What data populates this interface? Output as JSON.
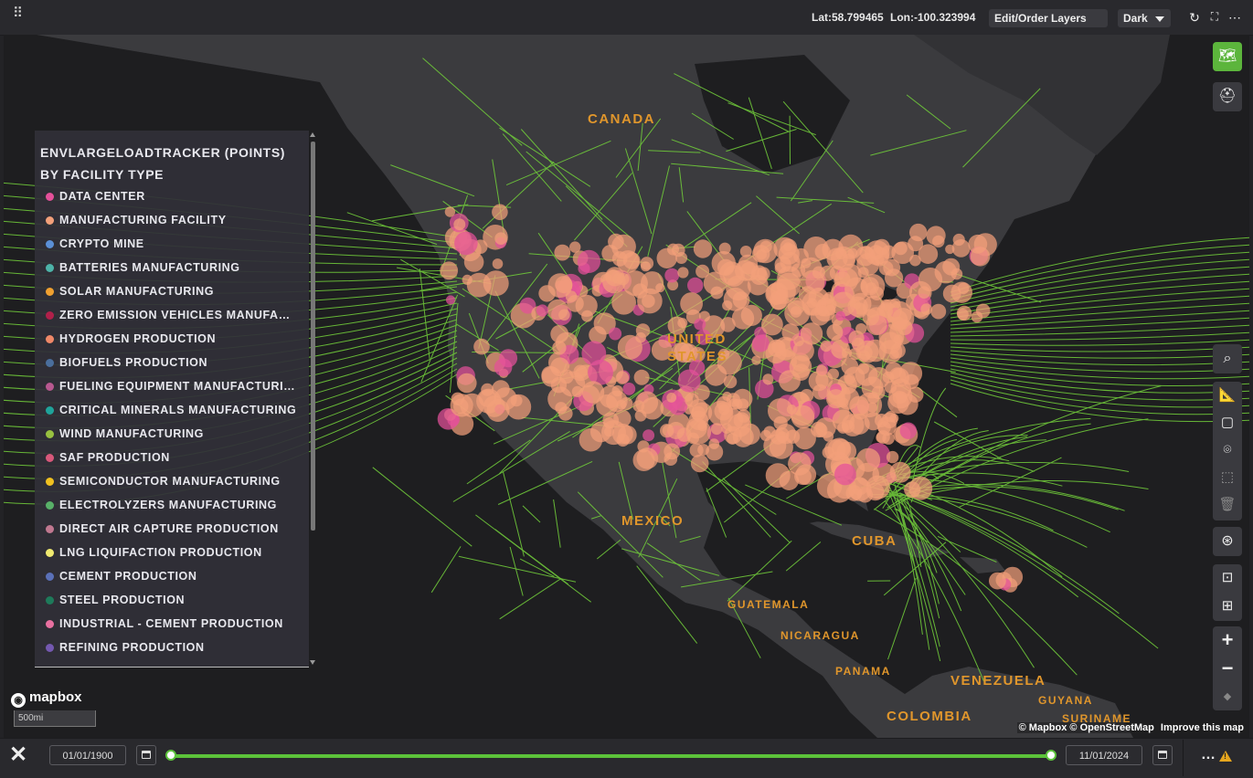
{
  "topbar": {
    "lat": "Lat:58.799465",
    "lon": "Lon:-100.323994",
    "layers_dropdown": "Edit/Order Layers",
    "theme_dropdown": "Dark"
  },
  "legend": {
    "title": "ENVLARGELOADTRACKER (POINTS) BY FACILITY TYPE",
    "items": [
      {
        "label": "DATA CENTER",
        "color": "#e4509a"
      },
      {
        "label": "MANUFACTURING FACILITY",
        "color": "#f2a07a"
      },
      {
        "label": "CRYPTO MINE",
        "color": "#5b8fd6"
      },
      {
        "label": "BATTERIES MANUFACTURING",
        "color": "#4db3a8"
      },
      {
        "label": "SOLAR MANUFACTURING",
        "color": "#f0a030"
      },
      {
        "label": "ZERO EMISSION VEHICLES MANUFACTU...",
        "color": "#b0204a"
      },
      {
        "label": "HYDROGEN PRODUCTION",
        "color": "#f08868"
      },
      {
        "label": "BIOFUELS PRODUCTION",
        "color": "#4a6e9c"
      },
      {
        "label": "FUELING EQUIPMENT MANUFACTURING",
        "color": "#b85890"
      },
      {
        "label": "CRITICAL MINERALS MANUFACTURING",
        "color": "#1fa39a"
      },
      {
        "label": "WIND MANUFACTURING",
        "color": "#98c040"
      },
      {
        "label": "SAF PRODUCTION",
        "color": "#d8587a"
      },
      {
        "label": "SEMICONDUCTOR MANUFACTURING",
        "color": "#f0c020"
      },
      {
        "label": "ELECTROLYZERS MANUFACTURING",
        "color": "#58b068"
      },
      {
        "label": "DIRECT AIR CAPTURE PRODUCTION",
        "color": "#c07890"
      },
      {
        "label": "LNG LIQUIFACTION PRODUCTION",
        "color": "#f0ea70"
      },
      {
        "label": "CEMENT PRODUCTION",
        "color": "#5a70b8"
      },
      {
        "label": "STEEL PRODUCTION",
        "color": "#1e7a5a"
      },
      {
        "label": "INDUSTRIAL - CEMENT PRODUCTION",
        "color": "#e870a0"
      },
      {
        "label": "REFINING PRODUCTION",
        "color": "#7458b0"
      }
    ]
  },
  "map_labels": {
    "canada": "CANADA",
    "united_states_1": "UNITED",
    "united_states_2": "STATES",
    "mexico": "MEXICO",
    "cuba": "CUBA",
    "guatemala": "GUATEMALA",
    "nicaragua": "NICARAGUA",
    "panama": "PANAMA",
    "venezuela": "VENEZUELA",
    "guyana": "GUYANA",
    "suriname": "SURINAME",
    "colombia": "COLOMBIA"
  },
  "map_colors": {
    "land": "#3b3b3e",
    "water": "#1e1e20",
    "transmission_lines": "#6fc83a",
    "points_manufacturing": "#f2a07a",
    "points_datacenter": "#e4509a"
  },
  "attribution": {
    "mapbox": "© Mapbox",
    "osm": "© OpenStreetMap",
    "improve": "Improve this map"
  },
  "logo": "mapbox",
  "scale_label": "500mi",
  "timeline": {
    "start_date": "01/01/1900",
    "end_date": "11/01/2024"
  },
  "icons": {
    "grip": "grip-icon",
    "refresh": "refresh-icon",
    "fullscreen": "fullscreen-icon",
    "more": "more-icon",
    "basemap": "map-layers-icon",
    "construction": "hardhat-icon",
    "search": "search-icon",
    "measure": "ruler-icon",
    "draw_box": "draw-box-icon",
    "marker": "marker-icon",
    "select": "select-icon",
    "delete": "trash-icon",
    "lasso": "lasso-icon",
    "zoom_extent": "zoom-extent-icon",
    "zoom_selection": "zoom-selection-icon",
    "zoom_in": "plus-icon",
    "zoom_out": "minus-icon",
    "compass": "compass-icon",
    "close": "close-icon",
    "calendar": "calendar-icon",
    "warning": "warning-icon"
  }
}
